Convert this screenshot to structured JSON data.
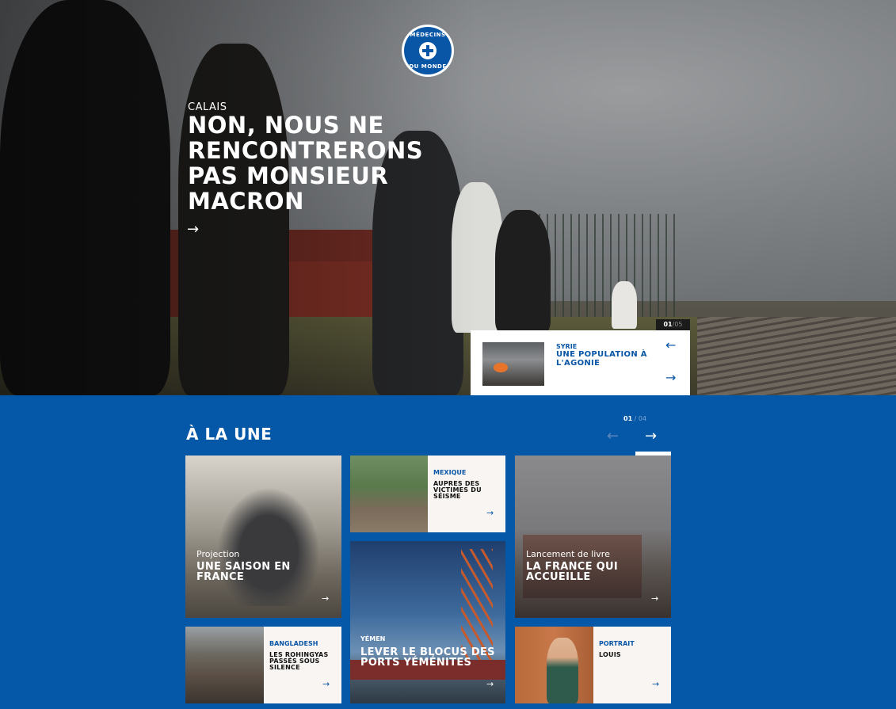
{
  "logo": {
    "top_text": "MÉDECINS",
    "bottom_text": "DU MONDE"
  },
  "hero": {
    "kicker": "CALAIS",
    "title": "NON, NOUS NE RENCONTRERONS PAS MONSIEUR MACRON",
    "arrow": "→",
    "slide_current": "01",
    "slide_total": "/05",
    "next": {
      "kicker": "SYRIE",
      "title": "UNE POPULATION À L'AGONIE",
      "prev_arrow": "←",
      "next_arrow": "→"
    }
  },
  "une": {
    "title": "À LA UNE",
    "count_current": "01",
    "count_total": " / 04",
    "prev_arrow": "←",
    "next_arrow": "→",
    "tiles": [
      {
        "kicker": "Projection",
        "title": "UNE SAISON EN FRANCE",
        "arrow": "→"
      },
      {
        "kicker": "MEXIQUE",
        "title": "AUPRES DES VICTIMES DU SÉISME",
        "arrow": "→"
      },
      {
        "kicker": "Lancement de livre",
        "title": "LA FRANCE QUI ACCUEILLE",
        "arrow": "→"
      },
      {
        "kicker": "YÉMEN",
        "title": "LEVER LE BLOCUS DES PORTS YÉMÉNITES",
        "arrow": "→"
      },
      {
        "kicker": "BANGLADESH",
        "title": "LES ROHINGYAS PASSÉS SOUS SILENCE",
        "arrow": "→"
      },
      {
        "kicker": "PORTRAIT",
        "title": "LOUIS",
        "arrow": "→"
      }
    ]
  }
}
